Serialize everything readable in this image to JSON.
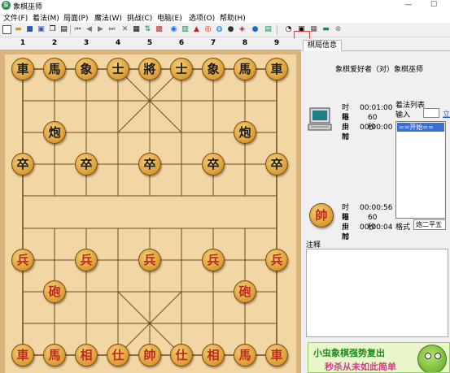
{
  "window": {
    "title": "象棋巫师",
    "app_icon": "象",
    "minimize": "—",
    "maximize": "☐"
  },
  "menu": [
    "文件(F)",
    "着法(M)",
    "局面(P)",
    "魔法(W)",
    "挑战(C)",
    "电脑(E)",
    "选项(O)",
    "帮助(H)"
  ],
  "toolbar": {
    "icons": [
      "new-file-icon",
      "open-folder-icon",
      "save-icon",
      "save-as-icon",
      "copy-icon",
      "paste-icon",
      "first-move-icon",
      "prev-move-icon",
      "next-move-icon",
      "last-move-icon",
      "delete-move-icon",
      "edit-board-icon",
      "flip-board-icon",
      "gallery-icon",
      "palette-icon",
      "book-icon",
      "play-icon",
      "target-icon",
      "eye-icon",
      "disc-icon",
      "help-icon",
      "timer-icon",
      "print-icon",
      "database-icon",
      "monitor-icon",
      "stop-icon"
    ],
    "highlight_color": "#e53935"
  },
  "file_labels": [
    "1",
    "2",
    "3",
    "4",
    "5",
    "6",
    "7",
    "8",
    "9"
  ],
  "board": {
    "black_back_row": [
      "車",
      "馬",
      "象",
      "士",
      "將",
      "士",
      "象",
      "馬",
      "車"
    ],
    "black_cannons": [
      "炮",
      "炮"
    ],
    "black_soldiers": [
      "卒",
      "卒",
      "卒",
      "卒",
      "卒"
    ],
    "red_soldiers": [
      "兵",
      "兵",
      "兵",
      "兵",
      "兵"
    ],
    "red_cannons": [
      "砲",
      "砲"
    ],
    "red_back_row": [
      "車",
      "馬",
      "相",
      "仕",
      "帥",
      "仕",
      "相",
      "馬",
      "車"
    ],
    "red_color": "#c0281a",
    "black_color": "#1a1a1a"
  },
  "panel": {
    "tab": "棋局信息",
    "match_title": "象棋爱好者（对）象棋巫师",
    "top_player": {
      "time_limit_label": "时限",
      "time_limit": "00:01:00",
      "increment_label": "每步加",
      "increment": "60 秒",
      "used_label": "用时",
      "used": "00:00:00"
    },
    "bottom_player": {
      "avatar": "帥",
      "time_limit_label": "时限",
      "time_limit": "00:00:56",
      "increment_label": "每步加",
      "increment": "60 秒",
      "used_label": "用时",
      "used": "00:00:04"
    },
    "moves": {
      "title": "着法列表",
      "input_label": "输入",
      "input_value": "",
      "input_link": "立",
      "selected": "==开始==",
      "format_label": "格式",
      "format_value": "炮二平五"
    },
    "notes_label": "注释"
  },
  "ad": {
    "line1": "小虫象棋强势复出",
    "line2": "秒杀从未如此简单"
  }
}
